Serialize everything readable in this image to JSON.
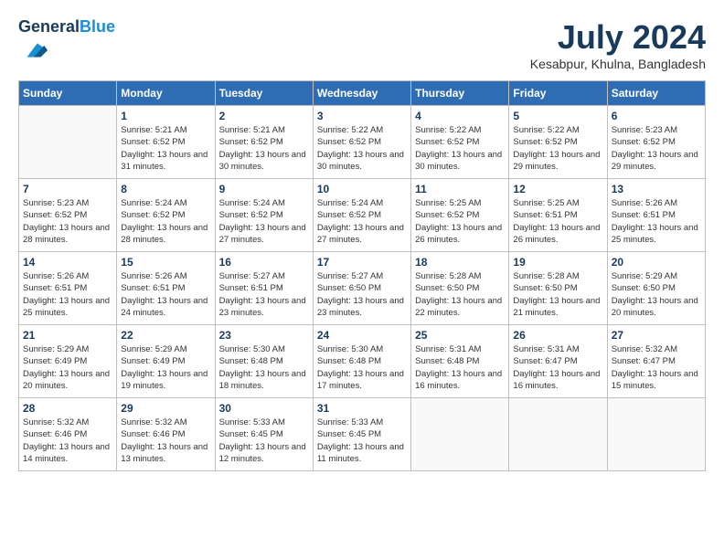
{
  "header": {
    "logo_line1": "General",
    "logo_line2": "Blue",
    "month_year": "July 2024",
    "location": "Kesabpur, Khulna, Bangladesh"
  },
  "days_of_week": [
    "Sunday",
    "Monday",
    "Tuesday",
    "Wednesday",
    "Thursday",
    "Friday",
    "Saturday"
  ],
  "weeks": [
    [
      {
        "day": "",
        "sunrise": "",
        "sunset": "",
        "daylight": ""
      },
      {
        "day": "1",
        "sunrise": "Sunrise: 5:21 AM",
        "sunset": "Sunset: 6:52 PM",
        "daylight": "Daylight: 13 hours and 31 minutes."
      },
      {
        "day": "2",
        "sunrise": "Sunrise: 5:21 AM",
        "sunset": "Sunset: 6:52 PM",
        "daylight": "Daylight: 13 hours and 30 minutes."
      },
      {
        "day": "3",
        "sunrise": "Sunrise: 5:22 AM",
        "sunset": "Sunset: 6:52 PM",
        "daylight": "Daylight: 13 hours and 30 minutes."
      },
      {
        "day": "4",
        "sunrise": "Sunrise: 5:22 AM",
        "sunset": "Sunset: 6:52 PM",
        "daylight": "Daylight: 13 hours and 30 minutes."
      },
      {
        "day": "5",
        "sunrise": "Sunrise: 5:22 AM",
        "sunset": "Sunset: 6:52 PM",
        "daylight": "Daylight: 13 hours and 29 minutes."
      },
      {
        "day": "6",
        "sunrise": "Sunrise: 5:23 AM",
        "sunset": "Sunset: 6:52 PM",
        "daylight": "Daylight: 13 hours and 29 minutes."
      }
    ],
    [
      {
        "day": "7",
        "sunrise": "Sunrise: 5:23 AM",
        "sunset": "Sunset: 6:52 PM",
        "daylight": "Daylight: 13 hours and 28 minutes."
      },
      {
        "day": "8",
        "sunrise": "Sunrise: 5:24 AM",
        "sunset": "Sunset: 6:52 PM",
        "daylight": "Daylight: 13 hours and 28 minutes."
      },
      {
        "day": "9",
        "sunrise": "Sunrise: 5:24 AM",
        "sunset": "Sunset: 6:52 PM",
        "daylight": "Daylight: 13 hours and 27 minutes."
      },
      {
        "day": "10",
        "sunrise": "Sunrise: 5:24 AM",
        "sunset": "Sunset: 6:52 PM",
        "daylight": "Daylight: 13 hours and 27 minutes."
      },
      {
        "day": "11",
        "sunrise": "Sunrise: 5:25 AM",
        "sunset": "Sunset: 6:52 PM",
        "daylight": "Daylight: 13 hours and 26 minutes."
      },
      {
        "day": "12",
        "sunrise": "Sunrise: 5:25 AM",
        "sunset": "Sunset: 6:51 PM",
        "daylight": "Daylight: 13 hours and 26 minutes."
      },
      {
        "day": "13",
        "sunrise": "Sunrise: 5:26 AM",
        "sunset": "Sunset: 6:51 PM",
        "daylight": "Daylight: 13 hours and 25 minutes."
      }
    ],
    [
      {
        "day": "14",
        "sunrise": "Sunrise: 5:26 AM",
        "sunset": "Sunset: 6:51 PM",
        "daylight": "Daylight: 13 hours and 25 minutes."
      },
      {
        "day": "15",
        "sunrise": "Sunrise: 5:26 AM",
        "sunset": "Sunset: 6:51 PM",
        "daylight": "Daylight: 13 hours and 24 minutes."
      },
      {
        "day": "16",
        "sunrise": "Sunrise: 5:27 AM",
        "sunset": "Sunset: 6:51 PM",
        "daylight": "Daylight: 13 hours and 23 minutes."
      },
      {
        "day": "17",
        "sunrise": "Sunrise: 5:27 AM",
        "sunset": "Sunset: 6:50 PM",
        "daylight": "Daylight: 13 hours and 23 minutes."
      },
      {
        "day": "18",
        "sunrise": "Sunrise: 5:28 AM",
        "sunset": "Sunset: 6:50 PM",
        "daylight": "Daylight: 13 hours and 22 minutes."
      },
      {
        "day": "19",
        "sunrise": "Sunrise: 5:28 AM",
        "sunset": "Sunset: 6:50 PM",
        "daylight": "Daylight: 13 hours and 21 minutes."
      },
      {
        "day": "20",
        "sunrise": "Sunrise: 5:29 AM",
        "sunset": "Sunset: 6:50 PM",
        "daylight": "Daylight: 13 hours and 20 minutes."
      }
    ],
    [
      {
        "day": "21",
        "sunrise": "Sunrise: 5:29 AM",
        "sunset": "Sunset: 6:49 PM",
        "daylight": "Daylight: 13 hours and 20 minutes."
      },
      {
        "day": "22",
        "sunrise": "Sunrise: 5:29 AM",
        "sunset": "Sunset: 6:49 PM",
        "daylight": "Daylight: 13 hours and 19 minutes."
      },
      {
        "day": "23",
        "sunrise": "Sunrise: 5:30 AM",
        "sunset": "Sunset: 6:48 PM",
        "daylight": "Daylight: 13 hours and 18 minutes."
      },
      {
        "day": "24",
        "sunrise": "Sunrise: 5:30 AM",
        "sunset": "Sunset: 6:48 PM",
        "daylight": "Daylight: 13 hours and 17 minutes."
      },
      {
        "day": "25",
        "sunrise": "Sunrise: 5:31 AM",
        "sunset": "Sunset: 6:48 PM",
        "daylight": "Daylight: 13 hours and 16 minutes."
      },
      {
        "day": "26",
        "sunrise": "Sunrise: 5:31 AM",
        "sunset": "Sunset: 6:47 PM",
        "daylight": "Daylight: 13 hours and 16 minutes."
      },
      {
        "day": "27",
        "sunrise": "Sunrise: 5:32 AM",
        "sunset": "Sunset: 6:47 PM",
        "daylight": "Daylight: 13 hours and 15 minutes."
      }
    ],
    [
      {
        "day": "28",
        "sunrise": "Sunrise: 5:32 AM",
        "sunset": "Sunset: 6:46 PM",
        "daylight": "Daylight: 13 hours and 14 minutes."
      },
      {
        "day": "29",
        "sunrise": "Sunrise: 5:32 AM",
        "sunset": "Sunset: 6:46 PM",
        "daylight": "Daylight: 13 hours and 13 minutes."
      },
      {
        "day": "30",
        "sunrise": "Sunrise: 5:33 AM",
        "sunset": "Sunset: 6:45 PM",
        "daylight": "Daylight: 13 hours and 12 minutes."
      },
      {
        "day": "31",
        "sunrise": "Sunrise: 5:33 AM",
        "sunset": "Sunset: 6:45 PM",
        "daylight": "Daylight: 13 hours and 11 minutes."
      },
      {
        "day": "",
        "sunrise": "",
        "sunset": "",
        "daylight": ""
      },
      {
        "day": "",
        "sunrise": "",
        "sunset": "",
        "daylight": ""
      },
      {
        "day": "",
        "sunrise": "",
        "sunset": "",
        "daylight": ""
      }
    ]
  ]
}
